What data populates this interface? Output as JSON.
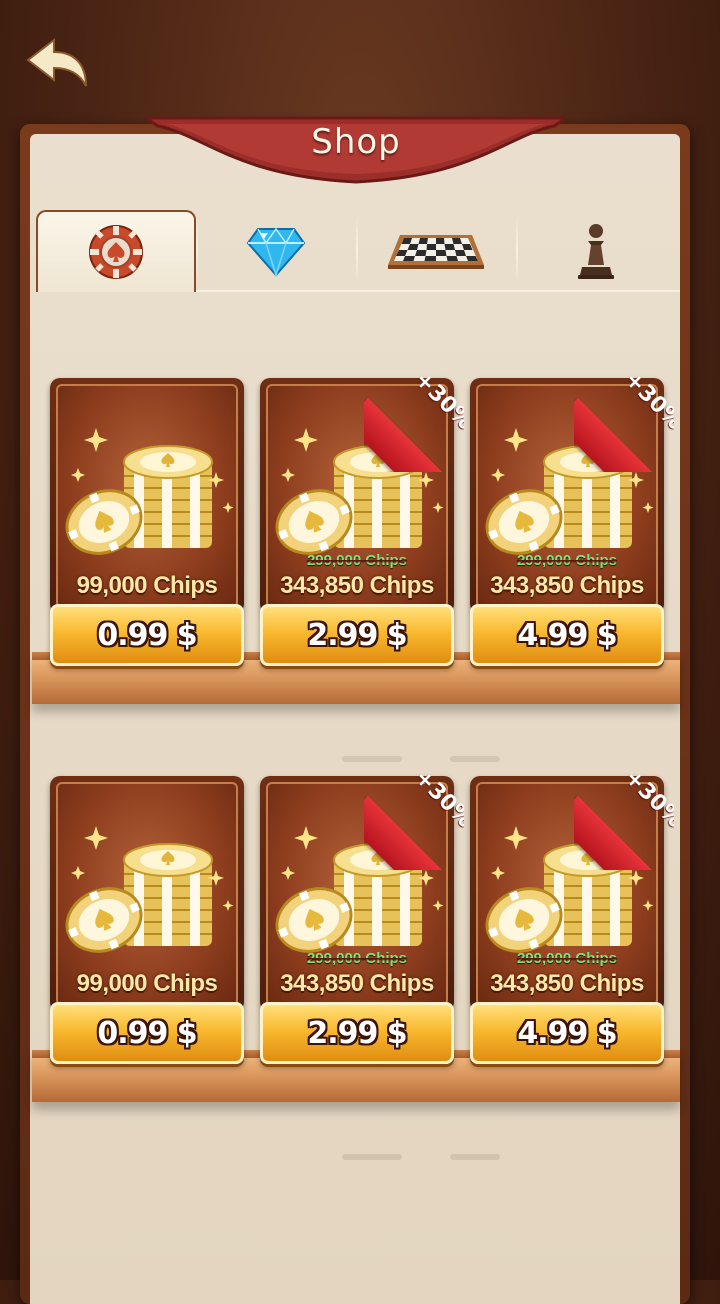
{
  "header": {
    "title": "Shop"
  },
  "tabs": [
    {
      "name": "chips",
      "icon": "poker-chip-icon",
      "active": true
    },
    {
      "name": "gems",
      "icon": "diamond-icon",
      "active": false
    },
    {
      "name": "boards",
      "icon": "checkerboard-icon",
      "active": false
    },
    {
      "name": "pieces",
      "icon": "chess-pawn-icon",
      "active": false
    }
  ],
  "products": [
    {
      "chips_label": "99,000 Chips",
      "old_chips": "",
      "price": "0.99 $",
      "bonus": ""
    },
    {
      "chips_label": "343,850 Chips",
      "old_chips": "299,000 Chips",
      "price": "2.99 $",
      "bonus": "+30%"
    },
    {
      "chips_label": "343,850 Chips",
      "old_chips": "299,000 Chips",
      "price": "4.99 $",
      "bonus": "+30%"
    },
    {
      "chips_label": "99,000 Chips",
      "old_chips": "",
      "price": "0.99 $",
      "bonus": ""
    },
    {
      "chips_label": "343,850 Chips",
      "old_chips": "299,000 Chips",
      "price": "2.99 $",
      "bonus": "+30%"
    },
    {
      "chips_label": "343,850 Chips",
      "old_chips": "299,000 Chips",
      "price": "4.99 $",
      "bonus": "+30%"
    }
  ],
  "colors": {
    "panel": "#e3d5bf",
    "frame": "#6e2e14",
    "button": "#f9b930",
    "ribbon": "#d42a30",
    "strike_text": "#7fe37a"
  }
}
